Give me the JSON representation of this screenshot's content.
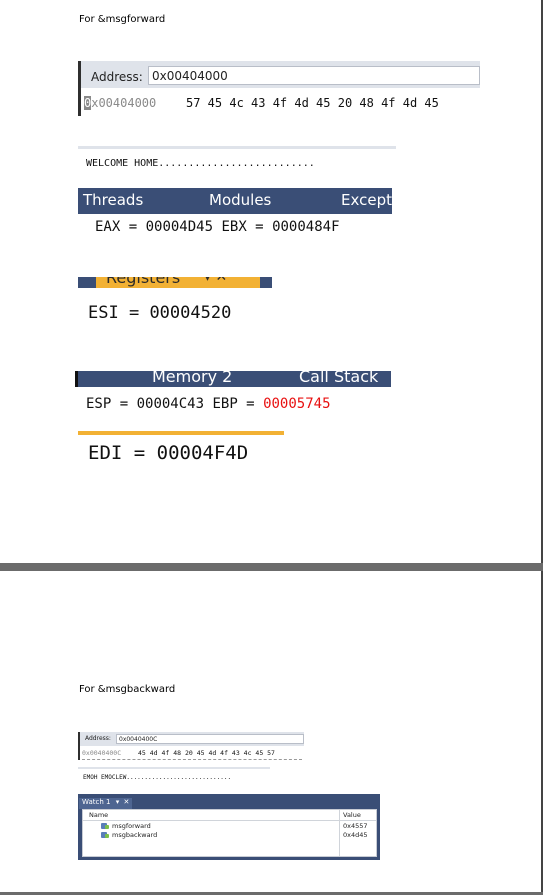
{
  "page1": {
    "heading": "For &msgforward",
    "memory_window": {
      "address_label": "Address:",
      "address_value": "0x00404000",
      "row_address": "0x00404000",
      "row_bytes": "57 45 4c 43 4f 4d 45 20 48 4f 4d 45"
    },
    "ascii_view": "WELCOME HOME..........................",
    "tabs_row1": [
      "Threads",
      "Modules",
      "Except"
    ],
    "regs_line1": {
      "eax_label": "EAX =",
      "eax": "00004D45",
      "ebx_label": "EBX =",
      "ebx": "0000484F"
    },
    "registers_tab": "Registers",
    "registers_tab_icons": "▾ ✕",
    "regs_line2": {
      "esi_label": "ESI =",
      "esi": "00004520"
    },
    "tabs_row2": [
      "Memory 2",
      "Call Stack"
    ],
    "regs_line3": {
      "esp_label": "ESP =",
      "esp": "00004C43",
      "ebp_label": "EBP =",
      "ebp": "00005745"
    },
    "regs_line4": {
      "edi_label": "EDI =",
      "edi": "00004F4D"
    }
  },
  "page2": {
    "heading": "For &msgbackward",
    "memory_window": {
      "address_label": "Address:",
      "address_value": "0x0040400C",
      "row_address": "0x0040400C",
      "row_bytes": "45 4d 4f 48 20 45 4d 4f 43 4c 45 57"
    },
    "ascii_view": "EMOH EMOCLEW.............................",
    "watch": {
      "title": "Watch 1",
      "pin_icon": "▾",
      "close_icon": "✕",
      "col_name": "Name",
      "col_value": "Value",
      "rows": [
        {
          "name": "msgforward",
          "value": "0x4557"
        },
        {
          "name": "msgbackward",
          "value": "0x4d45"
        }
      ]
    }
  },
  "colors": {
    "accent_bar": "#3a4e76",
    "changed_value": "#e81010",
    "highlight": "#f2b134"
  }
}
